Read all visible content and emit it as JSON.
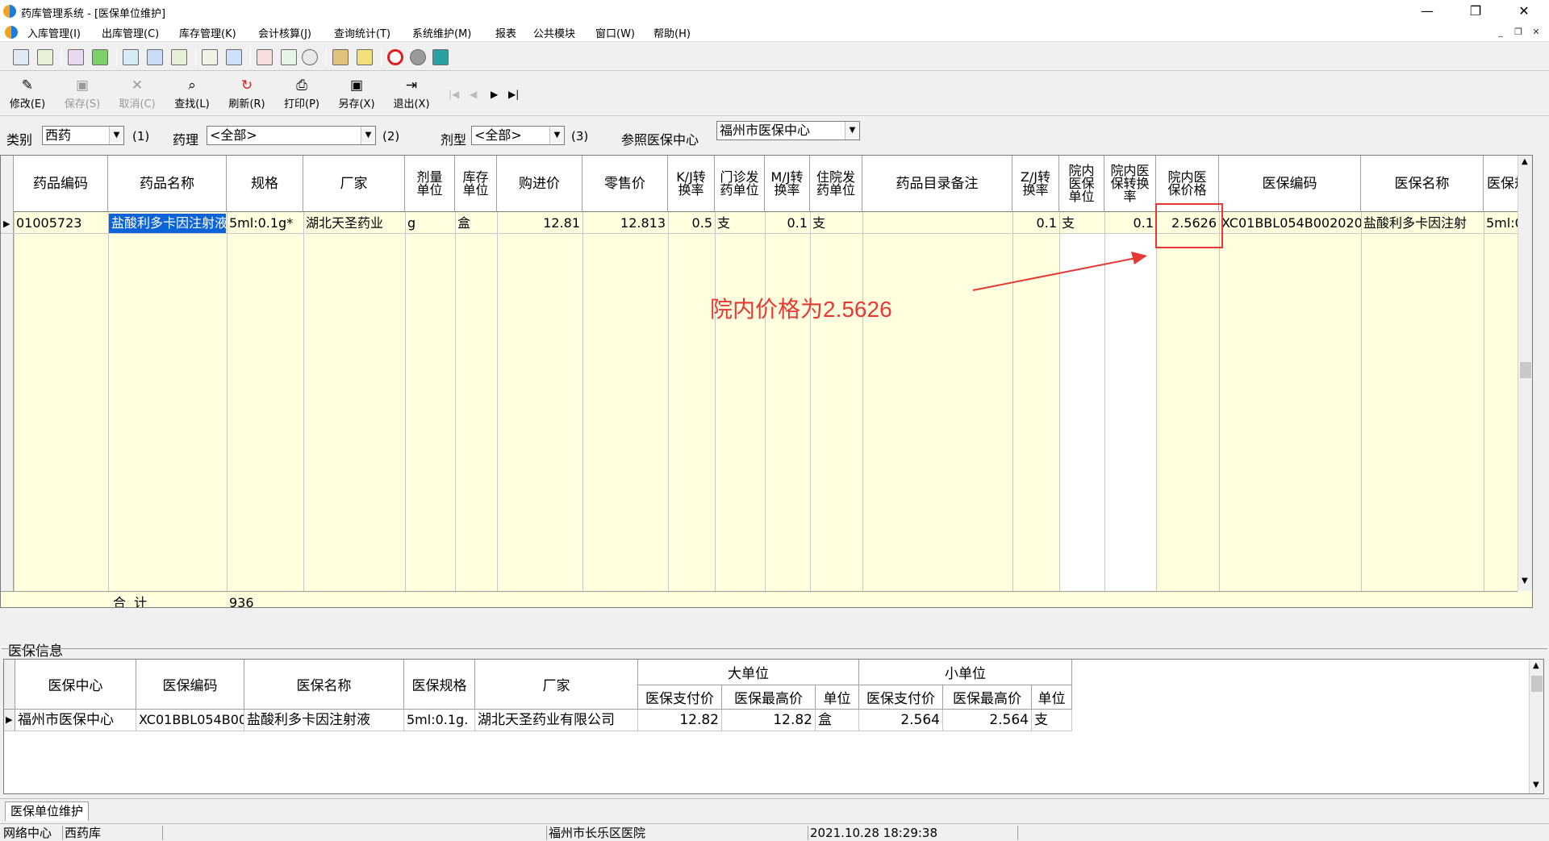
{
  "window": {
    "title": "药库管理系统 - [医保单位维护]",
    "min": "—",
    "max": "❐",
    "close": "✕"
  },
  "menu": [
    "入库管理(I)",
    "出库管理(C)",
    "库存管理(K)",
    "会计核算(J)",
    "查询统计(T)",
    "系统维护(M)",
    "报表",
    "公共模块",
    "窗口(W)",
    "帮助(H)"
  ],
  "toolbar_buttons": [
    {
      "label": "修改(E)",
      "icon": "edit-icon",
      "enabled": true
    },
    {
      "label": "保存(S)",
      "icon": "save-icon",
      "enabled": false
    },
    {
      "label": "取消(C)",
      "icon": "cancel-icon",
      "enabled": false
    },
    {
      "label": "查找(L)",
      "icon": "search-icon",
      "enabled": true
    },
    {
      "label": "刷新(R)",
      "icon": "refresh-icon",
      "enabled": true
    },
    {
      "label": "打印(P)",
      "icon": "print-icon",
      "enabled": true
    },
    {
      "label": "另存(X)",
      "icon": "save-as-icon",
      "enabled": true
    },
    {
      "label": "退出(X)",
      "icon": "exit-icon",
      "enabled": true
    }
  ],
  "filters": {
    "category_label": "类别",
    "category_value": "西药",
    "category_hotkey": "(1)",
    "pharm_label": "药理",
    "pharm_value": "<全部>",
    "pharm_hotkey": "(2)",
    "form_label": "剂型",
    "form_value": "<全部>",
    "form_hotkey": "(3)",
    "center_label": "参照医保中心",
    "center_value": "福州市医保中心"
  },
  "grid": {
    "headers": [
      "药品编码",
      "药品名称",
      "规格",
      "厂家",
      "剂量单位",
      "库存单位",
      "购进价",
      "零售价",
      "K/J转换率",
      "门诊发药单位",
      "M/J转换率",
      "住院发药单位",
      "药品目录备注",
      "Z/J转换率",
      "院内医保单位",
      "院内医保转换率",
      "院内医保价格",
      "医保编码",
      "医保名称",
      "医保规"
    ],
    "row": [
      "01005723",
      "盐酸利多卡因注射液",
      "5ml:0.1g*",
      "湖北天圣药业",
      "g",
      "盒",
      "12.81",
      "12.813",
      "0.5",
      "支",
      "0.1",
      "支",
      "",
      "0.1",
      "支",
      "0.1",
      "2.5626",
      "XC01BBL054B002020",
      "盐酸利多卡因注射",
      "5ml:0."
    ],
    "total_label": "合  计",
    "total_value": "936"
  },
  "annotation": {
    "text": "院内价格为2.5626",
    "color": "#e53935"
  },
  "sub_panel": {
    "group_label": "医保信息",
    "headers": [
      "医保中心",
      "医保编码",
      "医保名称",
      "医保规格",
      "厂家"
    ],
    "big_unit": "大单位",
    "small_unit": "小单位",
    "unit_headers": [
      "医保支付价",
      "医保最高价",
      "单位",
      "医保支付价",
      "医保最高价",
      "单位"
    ],
    "row": [
      "福州市医保中心",
      "XC01BBL054B00",
      "盐酸利多卡因注射液",
      "5ml:0.1g.",
      "湖北天圣药业有限公司",
      "12.82",
      "12.82",
      "盒",
      "2.564",
      "2.564",
      "支"
    ]
  },
  "tab_label": "医保单位维护",
  "status": [
    "网络中心",
    "西药库",
    "",
    "福州市长乐区医院",
    "2021.10.28 18:29:38"
  ]
}
